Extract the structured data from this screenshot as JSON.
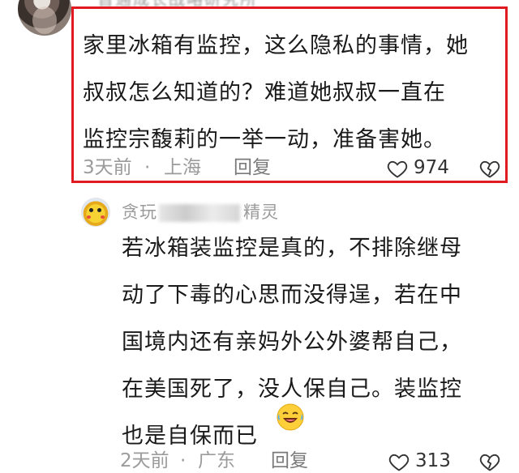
{
  "comment1": {
    "username": "晋通成长战略研究所",
    "text": "家里冰箱有监控，这么隐私的事情，她\n叔叔怎么知道的？难道她叔叔一直在\n监控宗馥莉的一举一动，准备害她。",
    "time": "3天前",
    "separator": "·",
    "location": "上海",
    "reply_label": "回复",
    "likes": "974",
    "highlight_color": "#e11a22"
  },
  "comment2": {
    "username_start": "贪玩",
    "username_end": "精灵",
    "text": "若冰箱装监控是真的，不排除继母\n动了下毒的心思而没得逞，若在中\n国境内还有亲妈外公外婆帮自己，\n在美国死了，没人保自己。装监控\n也是自保而已",
    "emoji": "laughing-crying-emoji",
    "time": "2天前",
    "separator": "·",
    "location": "广东",
    "reply_label": "回复",
    "likes": "313"
  },
  "colors": {
    "meta_text": "#9b9b9b",
    "body_text": "#1a1a1a"
  }
}
